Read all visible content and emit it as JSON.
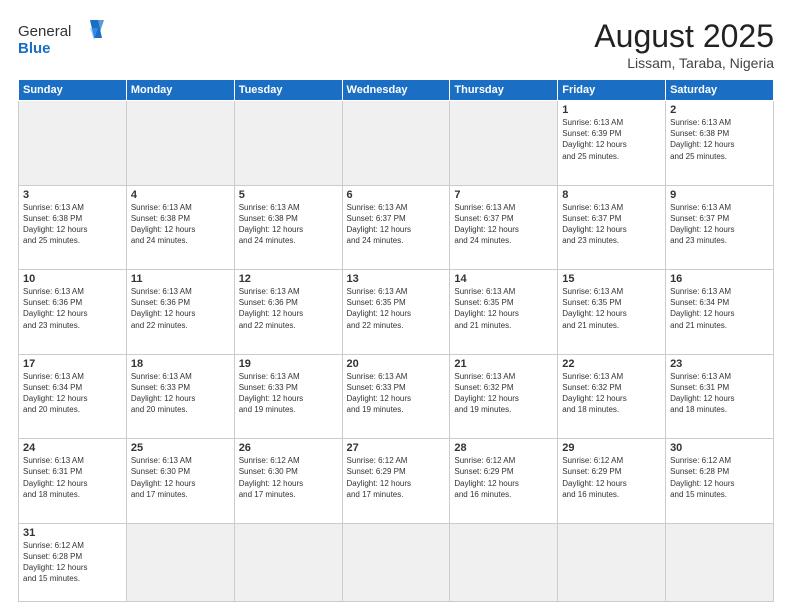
{
  "header": {
    "logo_general": "General",
    "logo_blue": "Blue",
    "month_year": "August 2025",
    "location": "Lissam, Taraba, Nigeria"
  },
  "weekdays": [
    "Sunday",
    "Monday",
    "Tuesday",
    "Wednesday",
    "Thursday",
    "Friday",
    "Saturday"
  ],
  "cells": [
    {
      "day": "",
      "info": "",
      "empty": true
    },
    {
      "day": "",
      "info": "",
      "empty": true
    },
    {
      "day": "",
      "info": "",
      "empty": true
    },
    {
      "day": "",
      "info": "",
      "empty": true
    },
    {
      "day": "",
      "info": "",
      "empty": true
    },
    {
      "day": "1",
      "info": "Sunrise: 6:13 AM\nSunset: 6:39 PM\nDaylight: 12 hours\nand 25 minutes.",
      "empty": false
    },
    {
      "day": "2",
      "info": "Sunrise: 6:13 AM\nSunset: 6:38 PM\nDaylight: 12 hours\nand 25 minutes.",
      "empty": false
    },
    {
      "day": "3",
      "info": "Sunrise: 6:13 AM\nSunset: 6:38 PM\nDaylight: 12 hours\nand 25 minutes.",
      "empty": false
    },
    {
      "day": "4",
      "info": "Sunrise: 6:13 AM\nSunset: 6:38 PM\nDaylight: 12 hours\nand 24 minutes.",
      "empty": false
    },
    {
      "day": "5",
      "info": "Sunrise: 6:13 AM\nSunset: 6:38 PM\nDaylight: 12 hours\nand 24 minutes.",
      "empty": false
    },
    {
      "day": "6",
      "info": "Sunrise: 6:13 AM\nSunset: 6:37 PM\nDaylight: 12 hours\nand 24 minutes.",
      "empty": false
    },
    {
      "day": "7",
      "info": "Sunrise: 6:13 AM\nSunset: 6:37 PM\nDaylight: 12 hours\nand 24 minutes.",
      "empty": false
    },
    {
      "day": "8",
      "info": "Sunrise: 6:13 AM\nSunset: 6:37 PM\nDaylight: 12 hours\nand 23 minutes.",
      "empty": false
    },
    {
      "day": "9",
      "info": "Sunrise: 6:13 AM\nSunset: 6:37 PM\nDaylight: 12 hours\nand 23 minutes.",
      "empty": false
    },
    {
      "day": "10",
      "info": "Sunrise: 6:13 AM\nSunset: 6:36 PM\nDaylight: 12 hours\nand 23 minutes.",
      "empty": false
    },
    {
      "day": "11",
      "info": "Sunrise: 6:13 AM\nSunset: 6:36 PM\nDaylight: 12 hours\nand 22 minutes.",
      "empty": false
    },
    {
      "day": "12",
      "info": "Sunrise: 6:13 AM\nSunset: 6:36 PM\nDaylight: 12 hours\nand 22 minutes.",
      "empty": false
    },
    {
      "day": "13",
      "info": "Sunrise: 6:13 AM\nSunset: 6:35 PM\nDaylight: 12 hours\nand 22 minutes.",
      "empty": false
    },
    {
      "day": "14",
      "info": "Sunrise: 6:13 AM\nSunset: 6:35 PM\nDaylight: 12 hours\nand 21 minutes.",
      "empty": false
    },
    {
      "day": "15",
      "info": "Sunrise: 6:13 AM\nSunset: 6:35 PM\nDaylight: 12 hours\nand 21 minutes.",
      "empty": false
    },
    {
      "day": "16",
      "info": "Sunrise: 6:13 AM\nSunset: 6:34 PM\nDaylight: 12 hours\nand 21 minutes.",
      "empty": false
    },
    {
      "day": "17",
      "info": "Sunrise: 6:13 AM\nSunset: 6:34 PM\nDaylight: 12 hours\nand 20 minutes.",
      "empty": false
    },
    {
      "day": "18",
      "info": "Sunrise: 6:13 AM\nSunset: 6:33 PM\nDaylight: 12 hours\nand 20 minutes.",
      "empty": false
    },
    {
      "day": "19",
      "info": "Sunrise: 6:13 AM\nSunset: 6:33 PM\nDaylight: 12 hours\nand 19 minutes.",
      "empty": false
    },
    {
      "day": "20",
      "info": "Sunrise: 6:13 AM\nSunset: 6:33 PM\nDaylight: 12 hours\nand 19 minutes.",
      "empty": false
    },
    {
      "day": "21",
      "info": "Sunrise: 6:13 AM\nSunset: 6:32 PM\nDaylight: 12 hours\nand 19 minutes.",
      "empty": false
    },
    {
      "day": "22",
      "info": "Sunrise: 6:13 AM\nSunset: 6:32 PM\nDaylight: 12 hours\nand 18 minutes.",
      "empty": false
    },
    {
      "day": "23",
      "info": "Sunrise: 6:13 AM\nSunset: 6:31 PM\nDaylight: 12 hours\nand 18 minutes.",
      "empty": false
    },
    {
      "day": "24",
      "info": "Sunrise: 6:13 AM\nSunset: 6:31 PM\nDaylight: 12 hours\nand 18 minutes.",
      "empty": false
    },
    {
      "day": "25",
      "info": "Sunrise: 6:13 AM\nSunset: 6:30 PM\nDaylight: 12 hours\nand 17 minutes.",
      "empty": false
    },
    {
      "day": "26",
      "info": "Sunrise: 6:12 AM\nSunset: 6:30 PM\nDaylight: 12 hours\nand 17 minutes.",
      "empty": false
    },
    {
      "day": "27",
      "info": "Sunrise: 6:12 AM\nSunset: 6:29 PM\nDaylight: 12 hours\nand 17 minutes.",
      "empty": false
    },
    {
      "day": "28",
      "info": "Sunrise: 6:12 AM\nSunset: 6:29 PM\nDaylight: 12 hours\nand 16 minutes.",
      "empty": false
    },
    {
      "day": "29",
      "info": "Sunrise: 6:12 AM\nSunset: 6:29 PM\nDaylight: 12 hours\nand 16 minutes.",
      "empty": false
    },
    {
      "day": "30",
      "info": "Sunrise: 6:12 AM\nSunset: 6:28 PM\nDaylight: 12 hours\nand 15 minutes.",
      "empty": false
    },
    {
      "day": "31",
      "info": "Sunrise: 6:12 AM\nSunset: 6:28 PM\nDaylight: 12 hours\nand 15 minutes.",
      "empty": false
    },
    {
      "day": "",
      "info": "",
      "empty": true
    },
    {
      "day": "",
      "info": "",
      "empty": true
    },
    {
      "day": "",
      "info": "",
      "empty": true
    },
    {
      "day": "",
      "info": "",
      "empty": true
    },
    {
      "day": "",
      "info": "",
      "empty": true
    },
    {
      "day": "",
      "info": "",
      "empty": true
    }
  ]
}
